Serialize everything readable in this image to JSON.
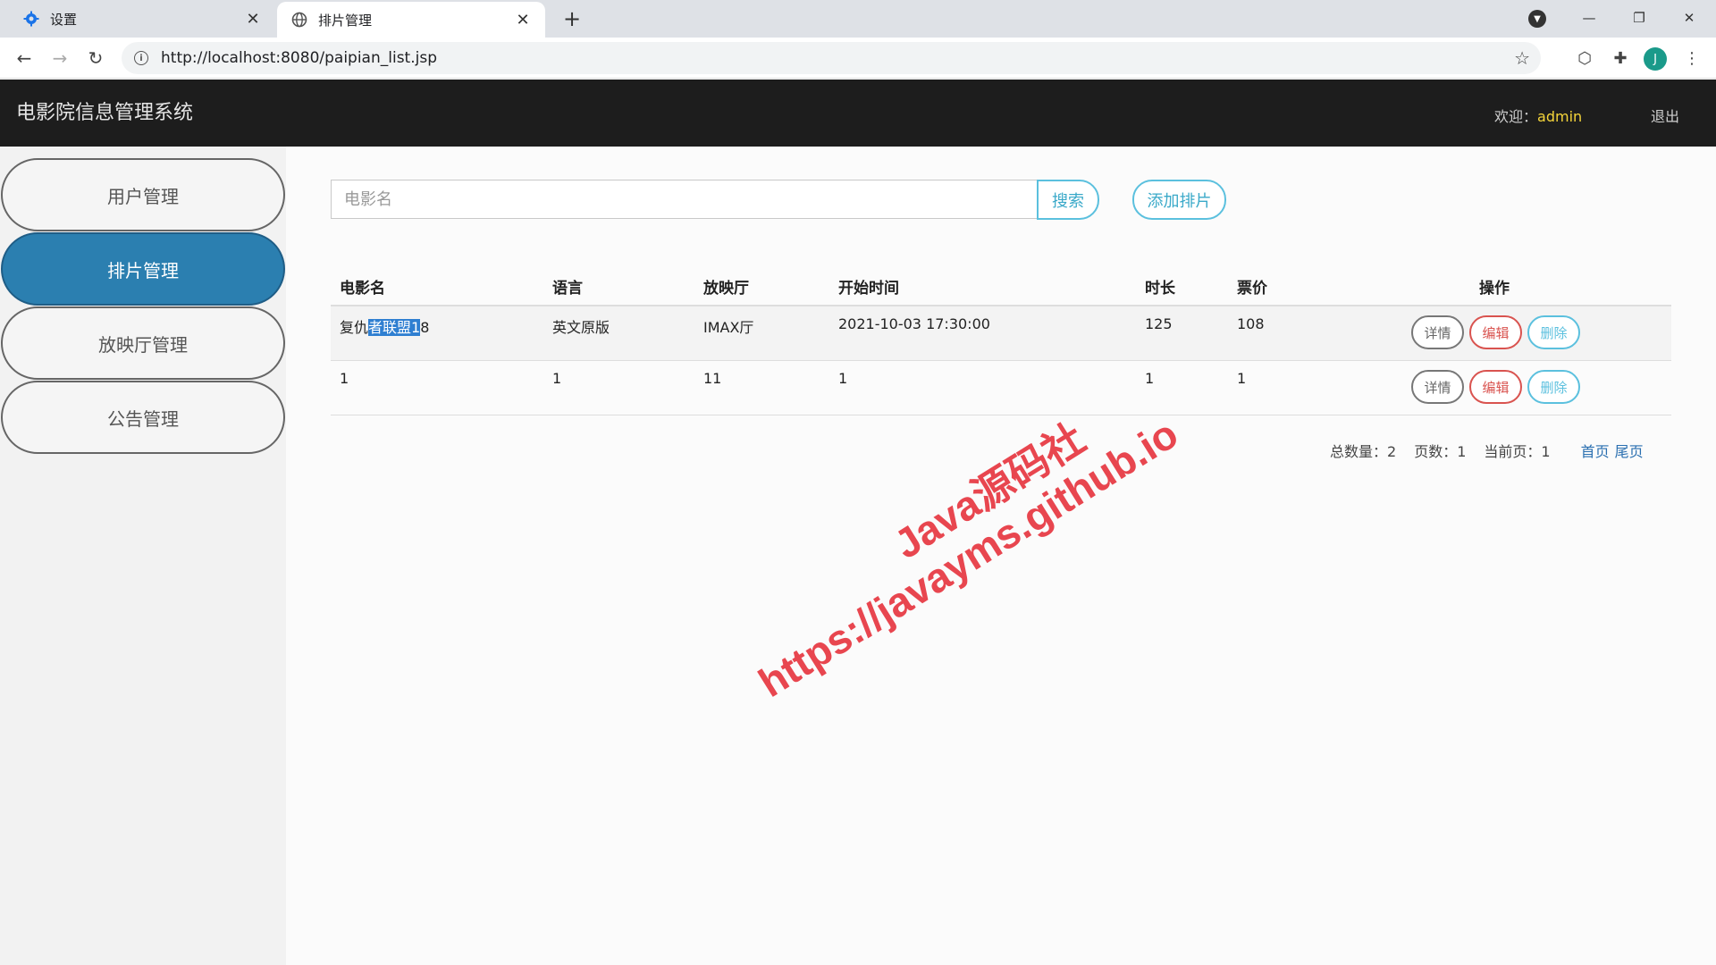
{
  "browser": {
    "tabs": [
      {
        "title": "设置",
        "icon": "gear-icon"
      },
      {
        "title": "排片管理",
        "icon": "globe-icon"
      }
    ],
    "url": "http://localhost:8080/paipian_list.jsp",
    "avatar_letter": "J"
  },
  "header": {
    "title": "电影院信息管理系统",
    "welcome_label": "欢迎：",
    "username": "admin",
    "logout": "退出"
  },
  "sidebar": {
    "items": [
      {
        "label": "用户管理"
      },
      {
        "label": "排片管理"
      },
      {
        "label": "放映厅管理"
      },
      {
        "label": "公告管理"
      }
    ]
  },
  "search": {
    "placeholder": "电影名",
    "search_label": "搜索",
    "add_label": "添加排片"
  },
  "table": {
    "columns": [
      "电影名",
      "语言",
      "放映厅",
      "开始时间",
      "时长",
      "票价",
      "操作"
    ],
    "rows": [
      {
        "name_a": "复仇",
        "name_sel": "者联盟1",
        "name_b": "8",
        "lang": "英文原版",
        "hall": "IMAX厅",
        "start": "2021-10-03 17:30:00",
        "duration": "125",
        "price": "108"
      },
      {
        "name_a": "1",
        "name_sel": "",
        "name_b": "",
        "lang": "1",
        "hall": "11",
        "start": "1",
        "duration": "1",
        "price": "1"
      }
    ],
    "actions": {
      "detail": "详情",
      "edit": "编辑",
      "delete": "删除"
    }
  },
  "pager": {
    "total": "总数量：2",
    "pages": "页数：1",
    "current": "当前页：1",
    "first": "首页",
    "last": "尾页"
  },
  "watermark": {
    "line1": "Java源码社",
    "line2": "https://javayms.github.io"
  },
  "colors": {
    "header_bg": "#1d1d1d",
    "active_nav": "#2b7fb0",
    "info": "#5bc0de",
    "danger": "#d9534f",
    "watermark": "#e8464f"
  }
}
